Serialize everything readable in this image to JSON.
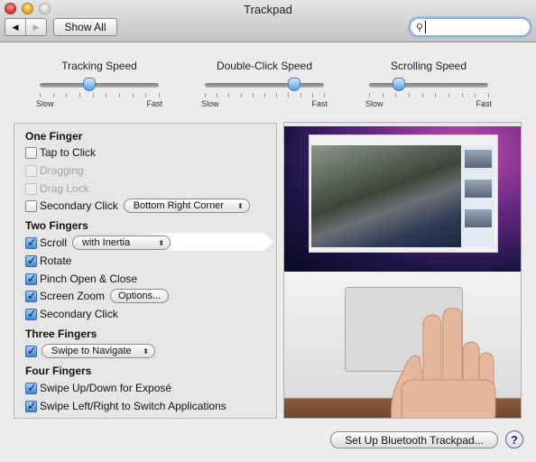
{
  "window": {
    "title": "Trackpad",
    "show_all_label": "Show All",
    "back_icon": "◀",
    "forward_icon": "▶",
    "search": {
      "placeholder": "",
      "value": "",
      "icon": "🔍"
    }
  },
  "sliders": [
    {
      "label": "Tracking Speed",
      "min_label": "Slow",
      "max_label": "Fast",
      "value": 0.42,
      "ticks": 10
    },
    {
      "label": "Double-Click Speed",
      "min_label": "Slow",
      "max_label": "Fast",
      "value": 0.75,
      "ticks": 11
    },
    {
      "label": "Scrolling Speed",
      "min_label": "Slow",
      "max_label": "Fast",
      "value": 0.25,
      "ticks": 10
    }
  ],
  "one_finger": {
    "heading": "One Finger",
    "tap_to_click": {
      "label": "Tap to Click",
      "checked": false
    },
    "dragging": {
      "label": "Dragging",
      "checked": false,
      "disabled": true
    },
    "drag_lock": {
      "label": "Drag Lock",
      "checked": false,
      "disabled": true
    },
    "secondary_click": {
      "label": "Secondary Click",
      "checked": false,
      "option": "Bottom Right Corner"
    }
  },
  "two_fingers": {
    "heading": "Two Fingers",
    "scroll": {
      "label": "Scroll",
      "checked": true,
      "option": "with Inertia"
    },
    "rotate": {
      "label": "Rotate",
      "checked": true
    },
    "pinch": {
      "label": "Pinch Open & Close",
      "checked": true
    },
    "screen_zoom": {
      "label": "Screen Zoom",
      "checked": true,
      "options_button": "Options..."
    },
    "secondary_click": {
      "label": "Secondary Click",
      "checked": true
    }
  },
  "three_fingers": {
    "heading": "Three Fingers",
    "swipe": {
      "checked": true,
      "option": "Swipe to Navigate"
    }
  },
  "four_fingers": {
    "heading": "Four Fingers",
    "expose": {
      "label": "Swipe Up/Down for Exposé",
      "checked": true
    },
    "switch_apps": {
      "label": "Swipe Left/Right to Switch Applications",
      "checked": true
    }
  },
  "footer": {
    "setup_button": "Set Up Bluetooth Trackpad...",
    "help_label": "?"
  }
}
